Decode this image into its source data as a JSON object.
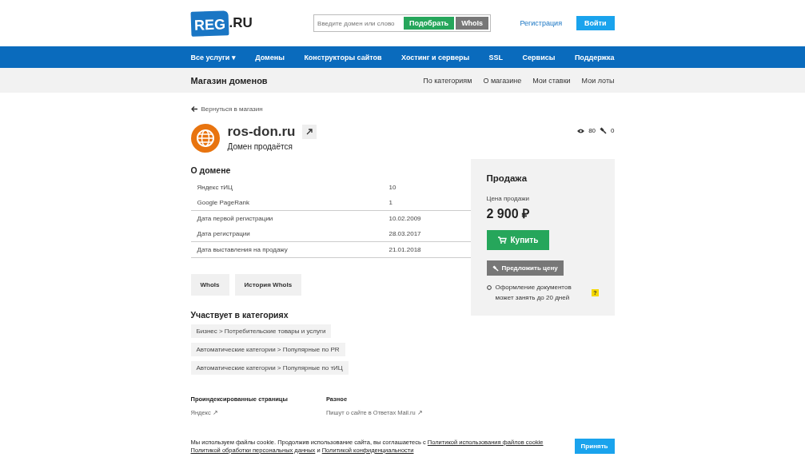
{
  "header": {
    "logo": "REG",
    "logo_suffix": ".RU",
    "search": {
      "placeholder": "Введите домен или слово",
      "pick_button": "Подобрать",
      "whois_button": "WhoIs"
    },
    "register_link": "Регистрация",
    "login_button": "Войти"
  },
  "nav": [
    "Все услуги ▾",
    "Домены",
    "Конструкторы сайтов",
    "Хостинг и серверы",
    "SSL",
    "Сервисы",
    "Поддержка"
  ],
  "subnav": {
    "title": "Магазин доменов",
    "links": [
      "По категориям",
      "О магазине",
      "Мои ставки",
      "Мои лоты"
    ]
  },
  "back_link": "Вернуться в магазин",
  "domain": {
    "name": "ros-don.ru",
    "status": "Домен продаётся",
    "views": "80",
    "bids": "0"
  },
  "about": {
    "title": "О домене",
    "groups": [
      [
        {
          "label": "Яндекс тИЦ",
          "value": "10"
        },
        {
          "label": "Google PageRank",
          "value": "1"
        }
      ],
      [
        {
          "label": "Дата первой регистрации",
          "value": "10.02.2009"
        },
        {
          "label": "Дата регистрации",
          "value": "28.03.2017"
        }
      ],
      [
        {
          "label": "Дата выставления на продажу",
          "value": "21.01.2018"
        }
      ]
    ]
  },
  "buttons": [
    "WhoIs",
    "История WhoIs"
  ],
  "categories": {
    "title": "Участвует в категориях",
    "items": [
      "Бизнес > Потребительские товары и услуги",
      "Автоматические категории > Популярные по PR",
      "Автоматические категории > Популярные по тИЦ"
    ]
  },
  "sale": {
    "title": "Продажа",
    "price_label": "Цена продажи",
    "price": "2 900 ₽",
    "buy_button": "Купить",
    "offer_button": "Предложить цену",
    "note": "Оформление документов может занять до 20 дней",
    "help": "?"
  },
  "footer": [
    {
      "title": "Проиндексированные страницы",
      "links": [
        "Яндекс ↗"
      ]
    },
    {
      "title": "Разное",
      "links": [
        "Пишут о сайте в Ответах Mail.ru ↗"
      ]
    }
  ],
  "cookie": {
    "text": "Мы используем файлы cookie. Продолжив использование сайта, вы соглашаетесь с ",
    "link1": "Политикой использования файлов cookie",
    "link2": "Политикой обработки персональных данных",
    "joiner": " и ",
    "link3": "Политикой конфиденциальности",
    "button": "Принять"
  }
}
